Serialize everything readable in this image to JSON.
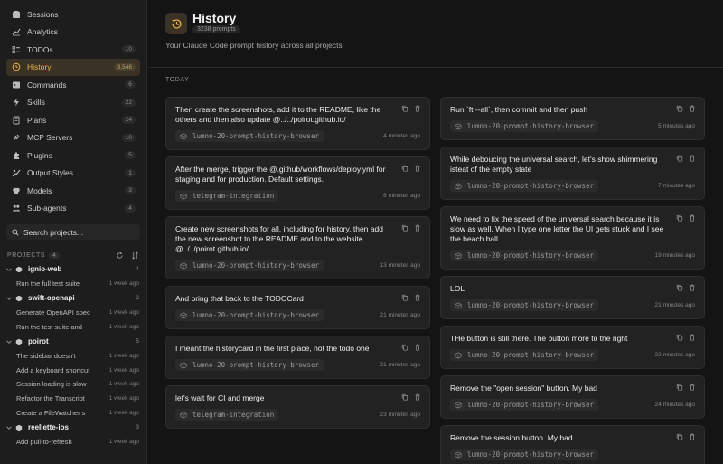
{
  "sidebar": {
    "nav": [
      {
        "label": "Sessions",
        "count": "",
        "icon": "sessions-icon"
      },
      {
        "label": "Analytics",
        "count": "",
        "icon": "analytics-icon"
      },
      {
        "label": "TODOs",
        "count": "10",
        "icon": "todos-icon"
      },
      {
        "label": "History",
        "count": "3,546",
        "icon": "history-icon"
      },
      {
        "label": "Commands",
        "count": "6",
        "icon": "commands-icon"
      },
      {
        "label": "Skills",
        "count": "22",
        "icon": "skills-icon"
      },
      {
        "label": "Plans",
        "count": "24",
        "icon": "plans-icon"
      },
      {
        "label": "MCP Servers",
        "count": "10",
        "icon": "mcp-servers-icon"
      },
      {
        "label": "Plugins",
        "count": "5",
        "icon": "plugins-icon"
      },
      {
        "label": "Output Styles",
        "count": "1",
        "icon": "output-styles-icon"
      },
      {
        "label": "Models",
        "count": "3",
        "icon": "models-icon"
      },
      {
        "label": "Sub-agents",
        "count": "4",
        "icon": "sub-agents-icon"
      }
    ],
    "search_label": "Search projects...",
    "projects_title": "PROJECTS",
    "projects_count": "4",
    "projects": [
      {
        "name": "ignio-web",
        "count": "1",
        "sessions": [
          {
            "title": "Run the full test suite",
            "time": "1 week ago"
          }
        ]
      },
      {
        "name": "swift-openapi",
        "count": "2",
        "sessions": [
          {
            "title": "Generate OpenAPI spec",
            "time": "1 week ago"
          },
          {
            "title": "Run the test suite and",
            "time": "1 week ago"
          }
        ]
      },
      {
        "name": "poirot",
        "count": "5",
        "sessions": [
          {
            "title": "The sidebar doesn't",
            "time": "1 week ago"
          },
          {
            "title": "Add a keyboard shortcut",
            "time": "1 week ago"
          },
          {
            "title": "Session loading is slow",
            "time": "1 week ago"
          },
          {
            "title": "Refactor the Transcript",
            "time": "1 week ago"
          },
          {
            "title": "Create a FileWatcher s",
            "time": "1 week ago"
          }
        ]
      },
      {
        "name": "reellette-ios",
        "count": "3",
        "sessions": [
          {
            "title": "Add pull-to-refresh",
            "time": "1 week ago"
          }
        ]
      }
    ]
  },
  "header": {
    "title": "History",
    "badge": "3238 prompts",
    "subtitle": "Your Claude Code prompt history across all projects"
  },
  "section_label": "TODAY",
  "left_cards": [
    {
      "text": "Then create the screenshots, add it to the README, like the others and then also update @../../poirot.github.io/",
      "project": "lumno-20-prompt-history-browser",
      "time": "4 minutes ago"
    },
    {
      "text": "After the merge, trigger the @.github/workflows/deploy.yml for staging and for production. Default settings.",
      "project": "telegram-integration",
      "time": "6 minutes ago"
    },
    {
      "text": "Create new screenshots for all, including for history, then add the new screenshot to the README and to the website @../../poirot.github.io/",
      "project": "lumno-20-prompt-history-browser",
      "time": "13 minutes ago"
    },
    {
      "text": "And bring that back to the TODOCard",
      "project": "lumno-20-prompt-history-browser",
      "time": "21 minutes ago"
    },
    {
      "text": "I meant the historycard in the first place, not the todo one",
      "project": "lumno-20-prompt-history-browser",
      "time": "21 minutes ago"
    },
    {
      "text": "let's wait for CI and merge",
      "project": "telegram-integration",
      "time": "23 minutes ago"
    }
  ],
  "right_cards": [
    {
      "text": "Run `ft --all`, then commit and then push",
      "project": "lumno-20-prompt-history-browser",
      "time": "5 minutes ago"
    },
    {
      "text": "While deboucing the universal search, let's show shimmering isteat of the empty state",
      "project": "lumno-20-prompt-history-browser",
      "time": "7 minutes ago"
    },
    {
      "text": "We need to fix the speed of the universal search because it is slow as well. When I type one letter the UI gets stuck and I see the beach ball.",
      "project": "lumno-20-prompt-history-browser",
      "time": "19 minutes ago"
    },
    {
      "text": "LOL",
      "project": "lumno-20-prompt-history-browser",
      "time": "21 minutes ago"
    },
    {
      "text": "THe button is still there. The button more to the right",
      "project": "lumno-20-prompt-history-browser",
      "time": "22 minutes ago"
    },
    {
      "text": "Remove the \"open session\" button. My bad",
      "project": "lumno-20-prompt-history-browser",
      "time": "24 minutes ago"
    },
    {
      "text": "Remove the session button. My bad",
      "project": "lumno-20-prompt-history-browser",
      "time": ""
    }
  ],
  "colors": {
    "accent": "#f0b24a",
    "active_bg": "#3a3224",
    "background": "#141414",
    "card": "#222222"
  }
}
